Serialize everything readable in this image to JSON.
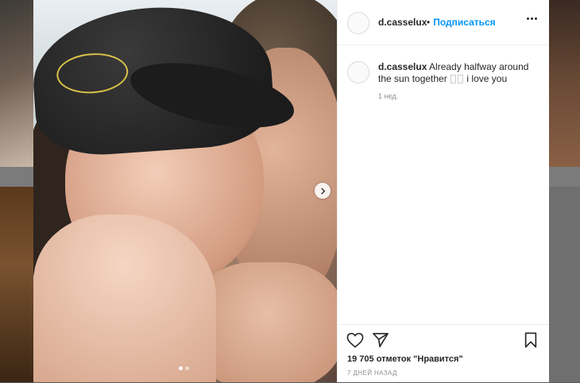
{
  "post": {
    "username": "d.casselux",
    "follow_label": "Подписаться",
    "follow_separator": "•",
    "caption_username": "d.casselux",
    "caption_text_1": "Already halfway around the sun together",
    "caption_text_2": "i love you",
    "comment_time": "1 нед.",
    "likes": "19 705 отметок \"Нравится\"",
    "date": "7 ДНЕЙ НАЗАД",
    "carousel": {
      "current_slide": 1,
      "total_slides": 2
    }
  },
  "icons": {
    "next": "chevron-right-icon",
    "like": "heart-icon",
    "share": "paper-plane-icon",
    "save": "bookmark-icon",
    "more": "more-horizontal-icon"
  },
  "colors": {
    "accent": "#0095f6",
    "text": "#262626",
    "secondary_text": "#8e8e8e",
    "overlay": "#5a5a5a"
  }
}
